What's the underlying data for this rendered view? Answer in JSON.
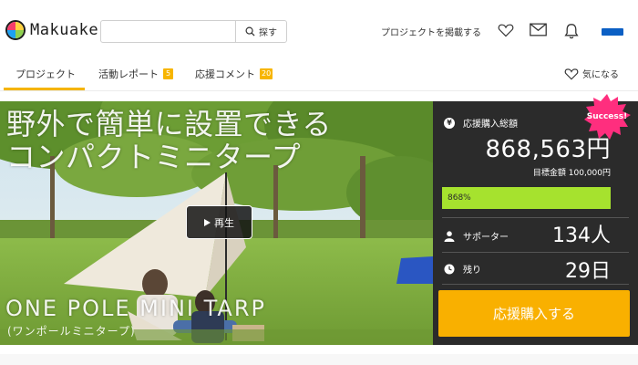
{
  "header": {
    "logo_text": "Makuake",
    "search_placeholder": "",
    "search_button": "探す",
    "post_project": "プロジェクトを掲載する",
    "icons": [
      "heart-icon",
      "mail-icon",
      "bell-icon"
    ]
  },
  "tabs": [
    {
      "label": "プロジェクト",
      "badge": ""
    },
    {
      "label": "活動レポート",
      "badge": "5"
    },
    {
      "label": "応援コメント",
      "badge": "20"
    }
  ],
  "favorite": "気になる",
  "hero": {
    "title_line1": "野外で簡単に設置できる",
    "title_line2": "コンパクトミニタープ",
    "subtitle": "ONE POLE MINI TARP",
    "subtitle_kana": "(ワンポールミニタープ)",
    "play_label": "再生"
  },
  "panel": {
    "total_label": "応援購入総額",
    "total_amount": "868,563円",
    "goal": "目標金額 100,000円",
    "progress_text": "868%",
    "progress_percent": 868,
    "supporters_label": "サポーター",
    "supporters_value": "134人",
    "remaining_label": "残り",
    "remaining_value": "29日",
    "buy_button": "応援購入する",
    "success_badge": "Success!"
  },
  "colors": {
    "accent": "#f9b000",
    "panel_bg": "#2b2b2b",
    "progress": "#a6e22e",
    "success": "#ff2e7e"
  }
}
